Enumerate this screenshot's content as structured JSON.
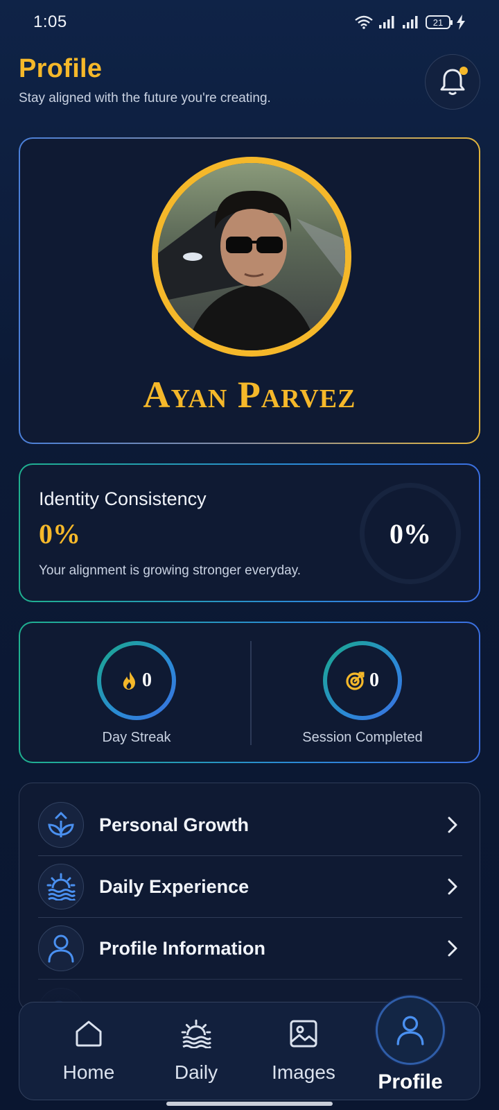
{
  "status_bar": {
    "time": "1:05",
    "battery": "21"
  },
  "header": {
    "title": "Profile",
    "subtitle": "Stay aligned with the future you're creating."
  },
  "profile": {
    "name": "Ayan Parvez"
  },
  "consistency": {
    "title": "Identity Consistency",
    "value": "0%",
    "caption": "Your alignment is growing stronger everyday.",
    "ring_value": "0%",
    "progress": 0
  },
  "stats": {
    "streak": {
      "value": "0",
      "label": "Day Streak",
      "icon": "flame-icon"
    },
    "sessions": {
      "value": "0",
      "label": "Session Completed",
      "icon": "target-icon"
    }
  },
  "menu": {
    "items": [
      {
        "label": "Personal Growth",
        "icon": "sprout-icon"
      },
      {
        "label": "Daily Experience",
        "icon": "sunrise-icon"
      },
      {
        "label": "Profile Information",
        "icon": "user-icon"
      }
    ]
  },
  "nav": {
    "items": [
      {
        "label": "Home",
        "icon": "home-icon"
      },
      {
        "label": "Daily",
        "icon": "sunrise-icon"
      },
      {
        "label": "Images",
        "icon": "image-icon"
      },
      {
        "label": "Profile",
        "icon": "user-icon",
        "active": true
      }
    ]
  },
  "colors": {
    "accent": "#f5b82a",
    "active_nav": "#4a90f0",
    "background": "#0c1a36"
  }
}
